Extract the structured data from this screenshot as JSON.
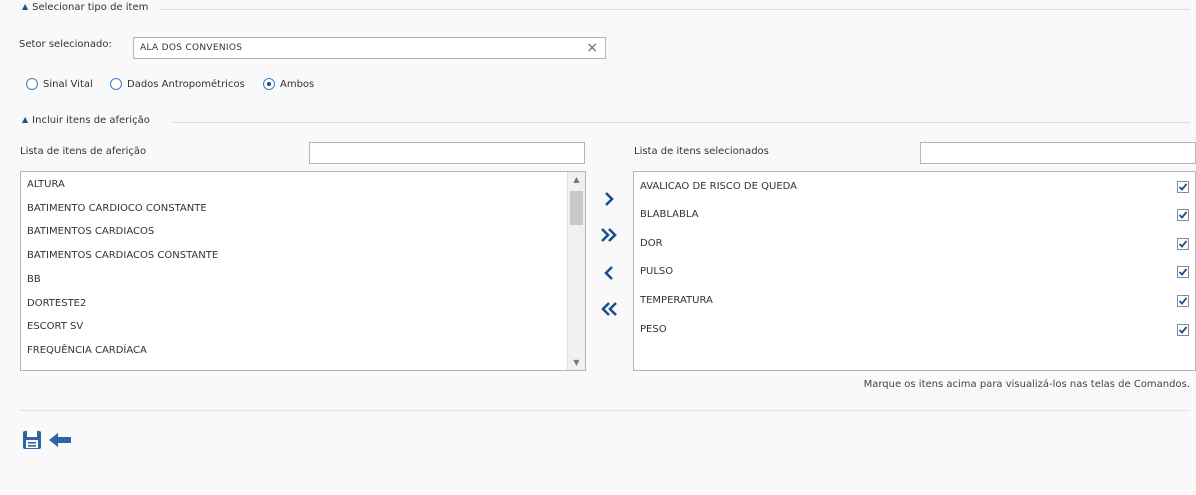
{
  "section_tipo": {
    "legend": "Selecionar tipo de item",
    "setor_label": "Setor selecionado:",
    "setor_value": "ALA DOS CONVENIOS",
    "clear_glyph": "×",
    "radios": [
      {
        "label": "Sinal Vital",
        "checked": false
      },
      {
        "label": "Dados Antropométricos",
        "checked": false
      },
      {
        "label": "Ambos",
        "checked": true
      }
    ]
  },
  "section_incluir": {
    "legend": "Incluir itens de aferição",
    "left_list": {
      "title": "Lista de itens de aferição",
      "filter_value": "",
      "items": [
        "ALTURA",
        "BATIMENTO CARDIOCO CONSTANTE",
        "BATIMENTOS CARDIACOS",
        "BATIMENTOS CARDIACOS CONSTANTE",
        "BB",
        "DORTESTE2",
        "ESCORT SV",
        "FREQUÊNCIA CARDÍACA"
      ]
    },
    "right_list": {
      "title": "Lista de itens selecionados",
      "filter_value": "",
      "items": [
        {
          "label": "AVALICAO DE RISCO DE QUEDA",
          "checked": true
        },
        {
          "label": "BLABLABLA",
          "checked": true
        },
        {
          "label": "DOR",
          "checked": true
        },
        {
          "label": "PULSO",
          "checked": true
        },
        {
          "label": "TEMPERATURA",
          "checked": true
        },
        {
          "label": "PESO",
          "checked": true
        }
      ]
    },
    "move_buttons": [
      {
        "name": "move-right-button",
        "glyph": "chevron-right-icon"
      },
      {
        "name": "move-all-right-button",
        "glyph": "double-chevron-right-icon"
      },
      {
        "name": "move-left-button",
        "glyph": "chevron-left-icon"
      },
      {
        "name": "move-all-left-button",
        "glyph": "double-chevron-left-icon"
      }
    ],
    "hint": "Marque os itens acima para visualizá-los nas telas de Comandos."
  },
  "toolbar": {
    "save_icon": "floppy-disk-icon",
    "back_icon": "arrow-left-icon"
  },
  "colors": {
    "accent": "#1f4e8c",
    "background": "#f9f9f9",
    "border": "#b5b5b5"
  }
}
